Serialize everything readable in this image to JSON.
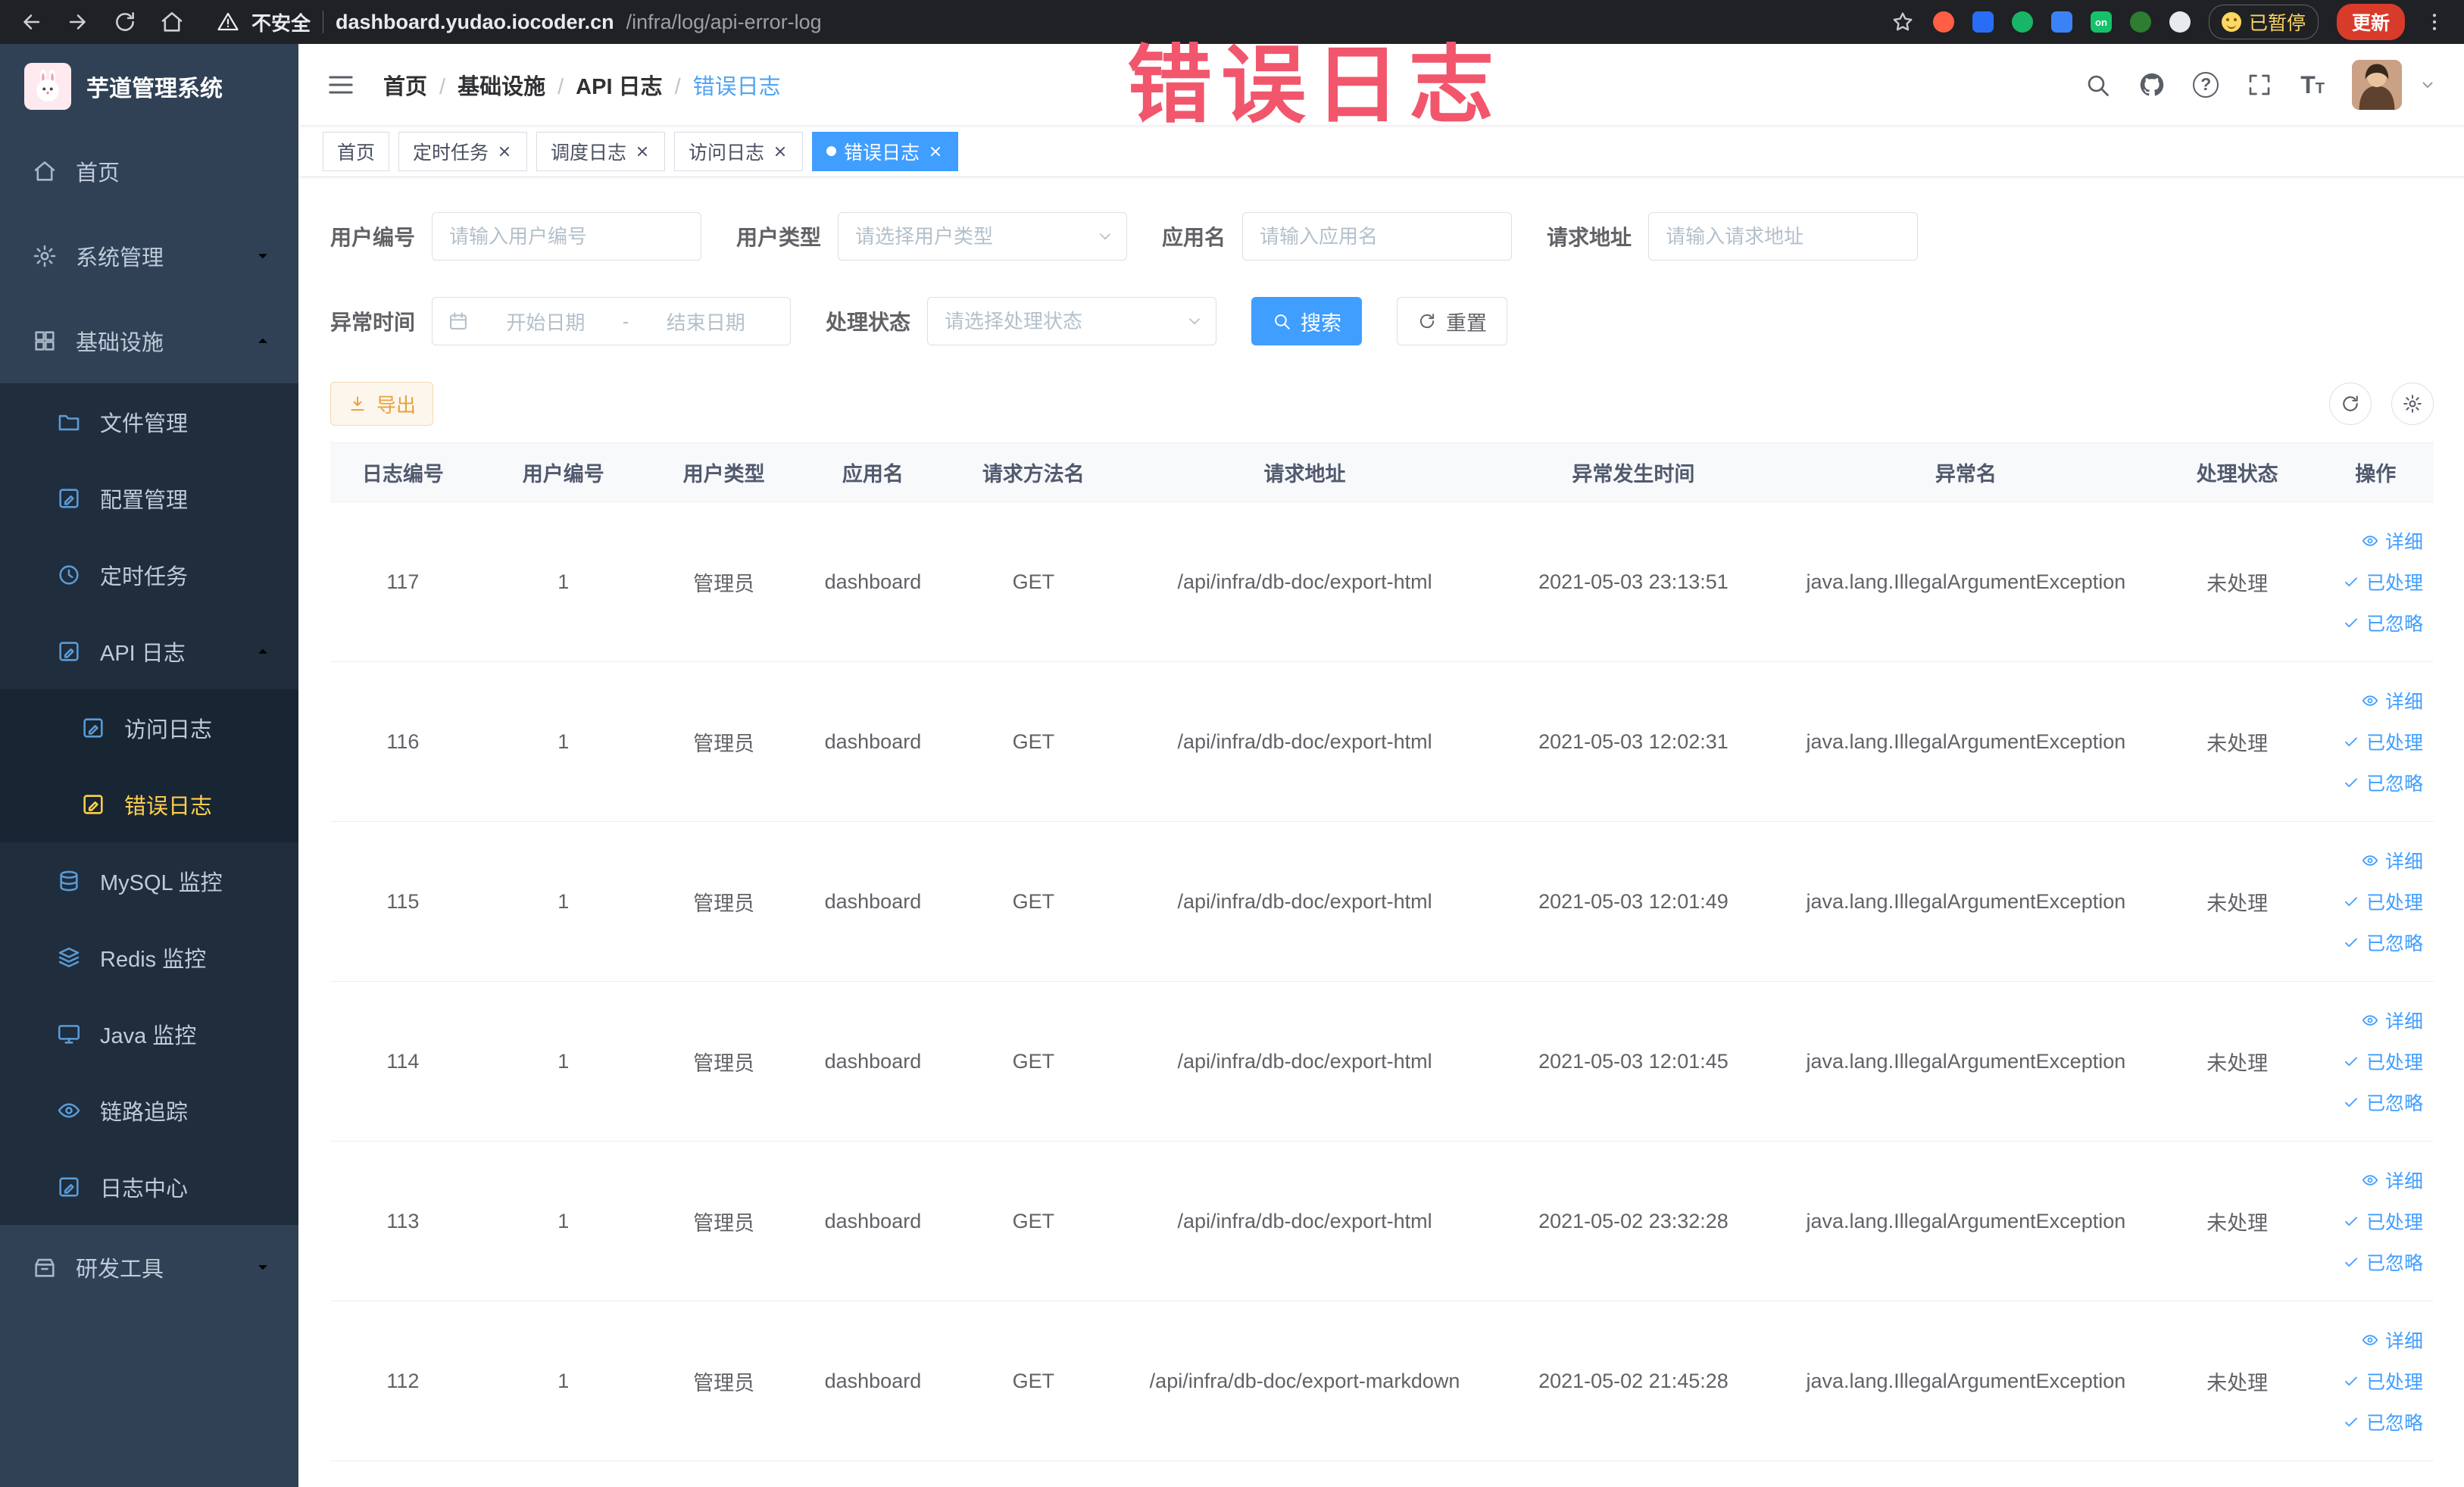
{
  "colors": {
    "primary": "#409eff",
    "warning": "#e6a23c",
    "sidebar_bg": "#304156",
    "submenu_bg": "#1f2d3d",
    "active_menu_text": "#ffd04b",
    "annotation": "#f1566c"
  },
  "annotation": {
    "watermark": "错误日志"
  },
  "browser": {
    "security_label": "不安全",
    "url_host": "dashboard.yudao.iocoder.cn",
    "url_path": "/infra/log/api-error-log",
    "paused_badge": "已暂停",
    "update_button": "更新",
    "on_extension": "on"
  },
  "sidebar": {
    "logo_title": "芋道管理系统",
    "items": [
      {
        "key": "home",
        "label": "首页",
        "icon": "home",
        "level": 1
      },
      {
        "key": "system",
        "label": "系统管理",
        "icon": "gear",
        "level": 1,
        "chevron": "down"
      },
      {
        "key": "infra",
        "label": "基础设施",
        "icon": "grid",
        "level": 1,
        "chevron": "up",
        "open": true
      },
      {
        "key": "file",
        "label": "文件管理",
        "icon": "folder",
        "level": 2
      },
      {
        "key": "config",
        "label": "配置管理",
        "icon": "docpen",
        "level": 2
      },
      {
        "key": "job",
        "label": "定时任务",
        "icon": "clock",
        "level": 2
      },
      {
        "key": "api-log",
        "label": "API 日志",
        "icon": "docpen",
        "level": 2,
        "chevron": "up",
        "open": true
      },
      {
        "key": "access-log",
        "label": "访问日志",
        "icon": "docpen",
        "level": 3
      },
      {
        "key": "error-log",
        "label": "错误日志",
        "icon": "docpen",
        "level": 3,
        "active": true
      },
      {
        "key": "mysql",
        "label": "MySQL 监控",
        "icon": "db",
        "level": 2
      },
      {
        "key": "redis",
        "label": "Redis 监控",
        "icon": "stack",
        "level": 2
      },
      {
        "key": "java",
        "label": "Java 监控",
        "icon": "display",
        "level": 2
      },
      {
        "key": "trace",
        "label": "链路追踪",
        "icon": "eye",
        "level": 2
      },
      {
        "key": "log-center",
        "label": "日志中心",
        "icon": "docpen",
        "level": 2
      },
      {
        "key": "dev-tools",
        "label": "研发工具",
        "icon": "toolbox",
        "level": 1,
        "chevron": "down"
      }
    ]
  },
  "navbar": {
    "breadcrumb": [
      "首页",
      "基础设施",
      "API 日志",
      "错误日志"
    ]
  },
  "tabs": [
    {
      "key": "home",
      "label": "首页",
      "closable": false,
      "active": false
    },
    {
      "key": "job",
      "label": "定时任务",
      "closable": true,
      "active": false
    },
    {
      "key": "job-log",
      "label": "调度日志",
      "closable": true,
      "active": false
    },
    {
      "key": "access-log",
      "label": "访问日志",
      "closable": true,
      "active": false
    },
    {
      "key": "error-log",
      "label": "错误日志",
      "closable": true,
      "active": true
    }
  ],
  "filters": {
    "user_id": {
      "label": "用户编号",
      "placeholder": "请输入用户编号"
    },
    "user_type": {
      "label": "用户类型",
      "placeholder": "请选择用户类型"
    },
    "app_name": {
      "label": "应用名",
      "placeholder": "请输入应用名"
    },
    "request_url": {
      "label": "请求地址",
      "placeholder": "请输入请求地址"
    },
    "exception_time": {
      "label": "异常时间",
      "start_placeholder": "开始日期",
      "separator": "-",
      "end_placeholder": "结束日期"
    },
    "process_status": {
      "label": "处理状态",
      "placeholder": "请选择处理状态"
    },
    "search_button": "搜索",
    "reset_button": "重置"
  },
  "toolbar": {
    "export_label": "导出"
  },
  "table": {
    "columns": [
      "日志编号",
      "用户编号",
      "用户类型",
      "应用名",
      "请求方法名",
      "请求地址",
      "异常发生时间",
      "异常名",
      "处理状态",
      "操作"
    ],
    "column_keys": [
      "log-id",
      "user-id",
      "user-type",
      "app-name",
      "method",
      "url",
      "time",
      "exception",
      "status"
    ],
    "action_labels": [
      "详细",
      "已处理",
      "已忽略"
    ],
    "rows": [
      [
        "117",
        "1",
        "管理员",
        "dashboard",
        "GET",
        "/api/infra/db-doc/export-html",
        "2021-05-03 23:13:51",
        "java.lang.IllegalArgumentException",
        "未处理"
      ],
      [
        "116",
        "1",
        "管理员",
        "dashboard",
        "GET",
        "/api/infra/db-doc/export-html",
        "2021-05-03 12:02:31",
        "java.lang.IllegalArgumentException",
        "未处理"
      ],
      [
        "115",
        "1",
        "管理员",
        "dashboard",
        "GET",
        "/api/infra/db-doc/export-html",
        "2021-05-03 12:01:49",
        "java.lang.IllegalArgumentException",
        "未处理"
      ],
      [
        "114",
        "1",
        "管理员",
        "dashboard",
        "GET",
        "/api/infra/db-doc/export-html",
        "2021-05-03 12:01:45",
        "java.lang.IllegalArgumentException",
        "未处理"
      ],
      [
        "113",
        "1",
        "管理员",
        "dashboard",
        "GET",
        "/api/infra/db-doc/export-html",
        "2021-05-02 23:32:28",
        "java.lang.IllegalArgumentException",
        "未处理"
      ],
      [
        "112",
        "1",
        "管理员",
        "dashboard",
        "GET",
        "/api/infra/db-doc/export-markdown",
        "2021-05-02 21:45:28",
        "java.lang.IllegalArgumentException",
        "未处理"
      ]
    ]
  }
}
